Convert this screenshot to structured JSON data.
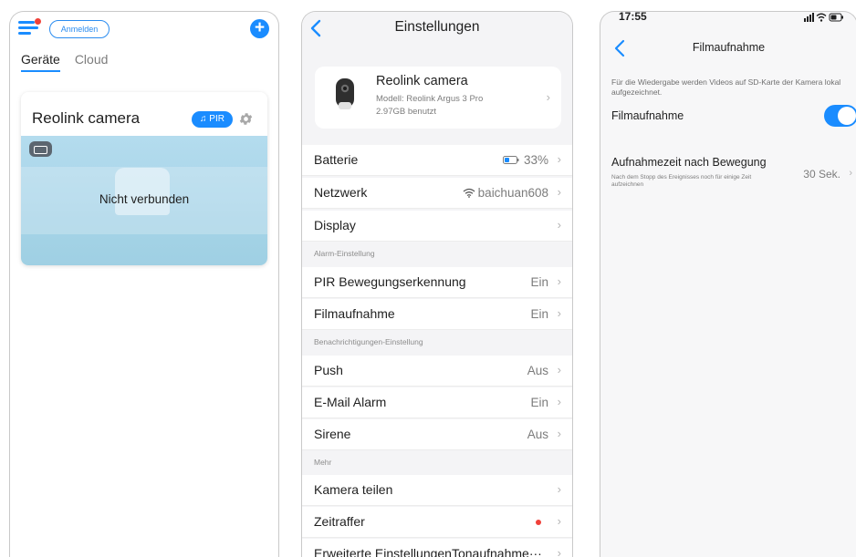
{
  "screen1": {
    "login_label": "Anmelden",
    "tabs": [
      {
        "label": "Geräte"
      },
      {
        "label": "Cloud"
      }
    ],
    "camera_name": "Reolink camera",
    "pir_label": "PIR",
    "status": "Nicht verbunden",
    "icons": [
      "menu-icon",
      "plus-icon",
      "bell-icon",
      "gear-icon",
      "battery-icon"
    ]
  },
  "screen2": {
    "title": "Einstellungen",
    "device": {
      "name": "Reolink camera",
      "model": "Modell:  Reolink Argus 3 Pro",
      "storage": "2.97GB benutzt"
    },
    "rows": [
      {
        "label": "Batterie",
        "value": "33%"
      },
      {
        "label": "Netzwerk",
        "value": "baichuan608"
      },
      {
        "label": "Display",
        "value": ""
      },
      {
        "label": "PIR Bewegungserkennung",
        "value": "Ein"
      },
      {
        "label": "Filmaufnahme",
        "value": "Ein"
      },
      {
        "label": "Push",
        "value": "Aus"
      },
      {
        "label": "E-Mail Alarm",
        "value": "Ein"
      },
      {
        "label": "Sirene",
        "value": "Aus"
      },
      {
        "label": "Kamera teilen",
        "value": ""
      },
      {
        "label": "Zeitraffer",
        "value": ""
      },
      {
        "label": "Erweiterte EinstellungenTonaufnahme···",
        "value": ""
      }
    ],
    "sections": {
      "alarm": "Alarm-Einstellung",
      "notify": "Benachrichtigungen-Einstellung",
      "more": "Mehr"
    },
    "accent_color": "#1a8cff",
    "dot_color": "#f0413a"
  },
  "screen3": {
    "time": "17:55",
    "title": "Filmaufnahme",
    "description": "Für die Wiedergabe werden Videos auf SD-Karte der Kamera lokal aufgezeichnet.",
    "recording_label": "Filmaufnahme",
    "recording_enabled": true,
    "post_motion": {
      "label": "Aufnahmezeit nach Bewegung",
      "description": "Nach dem Stopp des Ereignisses noch für einige Zeit aufzeichnen",
      "value": "30 Sek."
    }
  }
}
